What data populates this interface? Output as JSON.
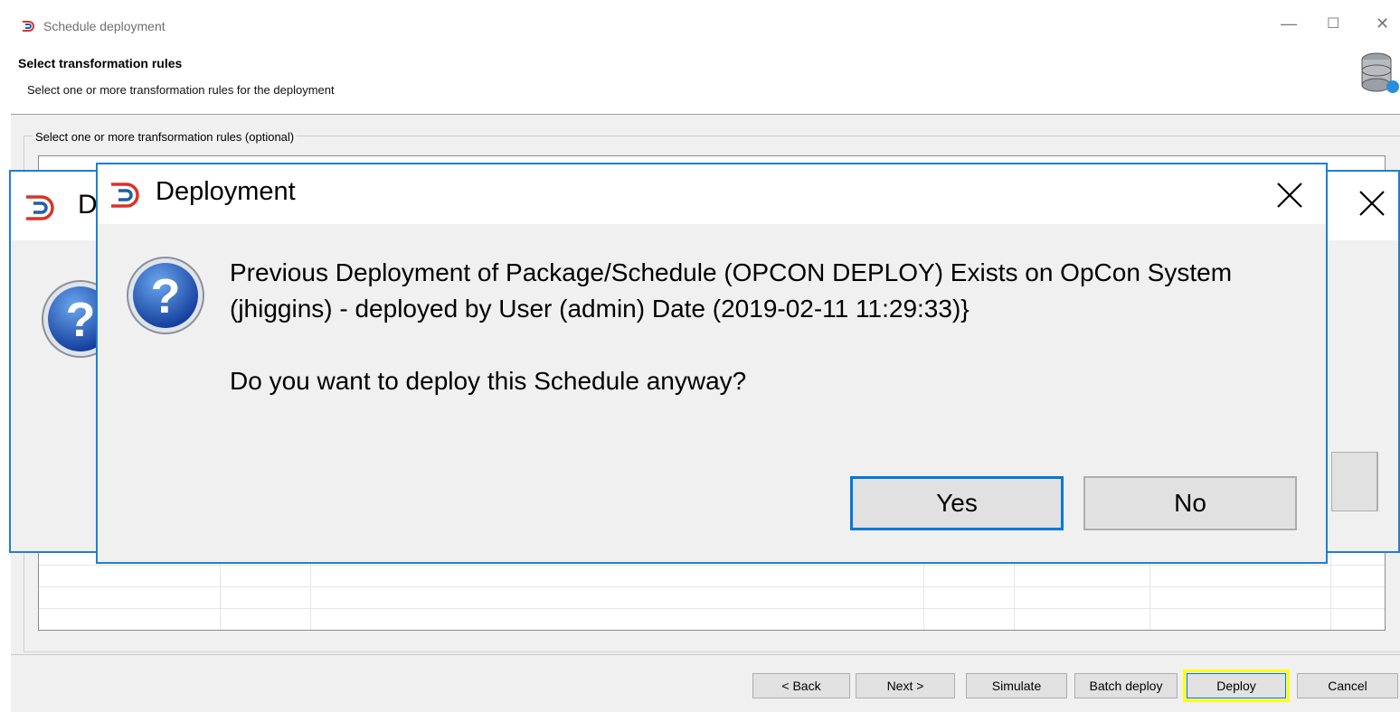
{
  "wizard": {
    "title": "Schedule deployment",
    "header_title": "Select transformation rules",
    "header_subtitle": "Select one or more transformation rules for the deployment",
    "group_label": "Select one or more tranfsormation rules (optional)",
    "buttons": {
      "back": "< Back",
      "next": "Next >",
      "simulate": "Simulate",
      "batch_deploy": "Batch deploy",
      "deploy": "Deploy",
      "cancel": "Cancel"
    }
  },
  "background_dialog": {
    "title": "D"
  },
  "dialog": {
    "title": "Deployment",
    "message": "Previous Deployment of Package/Schedule (OPCON DEPLOY) Exists on OpCon System (jhiggins) - deployed by User (admin) Date (2019-02-11 11:29:33)}",
    "prompt": "Do you want to deploy this Schedule anyway?",
    "yes_label": "Yes",
    "no_label": "No"
  },
  "colors": {
    "accent_blue": "#1e7fd3",
    "highlight_yellow": "#ffff00",
    "logo_red": "#d9332b",
    "logo_blue": "#1f5fa8"
  },
  "icons": [
    "app-logo-icon",
    "question-icon",
    "database-icon",
    "close-icon",
    "minimize-icon",
    "maximize-icon"
  ]
}
